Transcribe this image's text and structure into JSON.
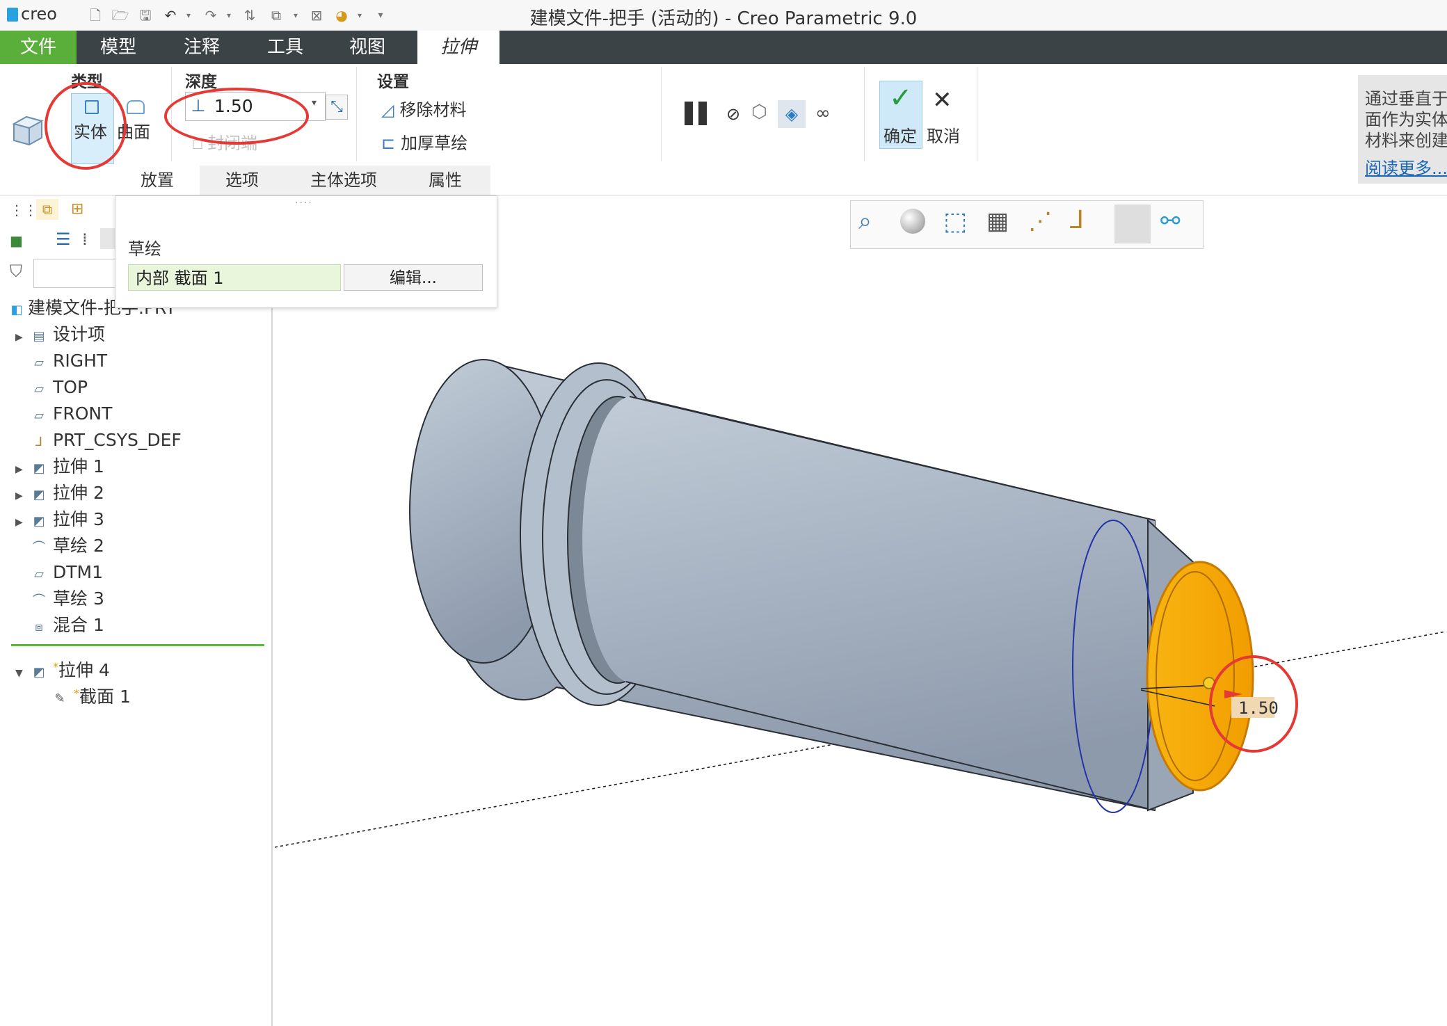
{
  "window_title": "建模文件-把手 (活动的) - Creo Parametric 9.0",
  "app_logo": "creo",
  "ribbon_tabs": [
    "文件",
    "模型",
    "注释",
    "工具",
    "视图",
    "拉伸"
  ],
  "type_group": {
    "label": "类型",
    "solid": "实体",
    "surface": "曲面"
  },
  "depth_group": {
    "label": "深度",
    "value": "1.50",
    "capped_ends": "封闭端"
  },
  "settings_group": {
    "label": "设置",
    "remove_material": "移除材料",
    "thicken_sketch": "加厚草绘"
  },
  "actions": {
    "ok": "确定",
    "cancel": "取消"
  },
  "dashboard_tabs": [
    "放置",
    "选项",
    "主体选项",
    "属性"
  ],
  "placement_panel": {
    "heading": "草绘",
    "sketch_ref": "内部 截面 1",
    "edit_button": "编辑..."
  },
  "info_panel": {
    "lines": [
      "通过垂直于",
      "面作为实体",
      "材料来创建"
    ],
    "link": "阅读更多..."
  },
  "model_tree": {
    "root": "建模文件-把手.PRT",
    "items": [
      "设计项",
      "RIGHT",
      "TOP",
      "FRONT",
      "PRT_CSYS_DEF",
      "拉伸 1",
      "拉伸 2",
      "拉伸 3",
      "草绘 2",
      "DTM1",
      "草绘 3",
      "混合 1"
    ],
    "active_feature": "拉伸 4",
    "active_child": "截面 1"
  },
  "graphics": {
    "dimension_label": "1.50"
  },
  "colors": {
    "file_tab": "#5aae3a",
    "ribbon_dark": "#3b4347",
    "highlight": "#f5a100",
    "annotation_red": "#e53935",
    "model_fill": "#aab6c4"
  }
}
